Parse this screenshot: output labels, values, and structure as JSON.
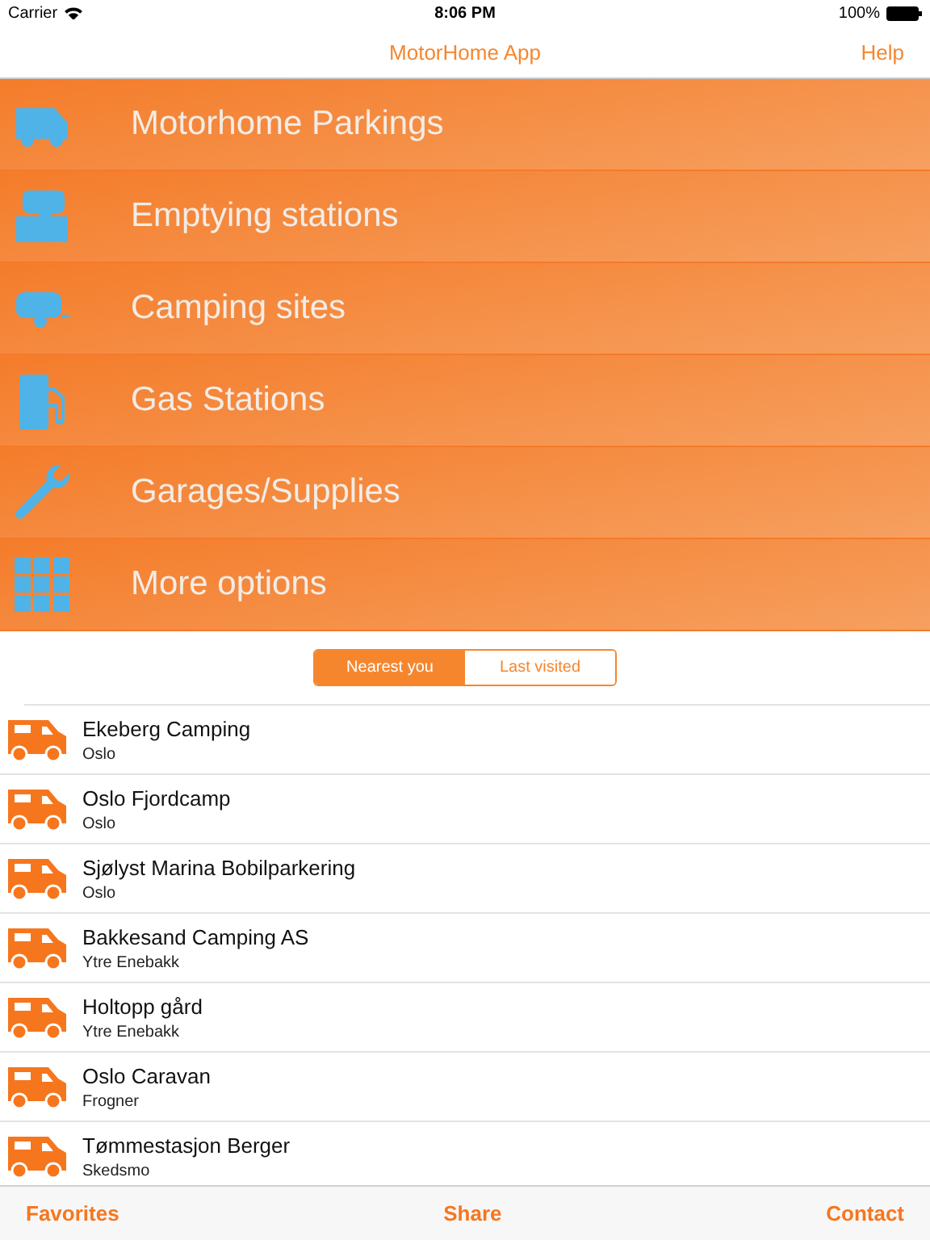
{
  "status_bar": {
    "carrier": "Carrier",
    "time": "8:06 PM",
    "battery": "100%"
  },
  "nav": {
    "title": "MotorHome App",
    "right": "Help"
  },
  "menu": [
    {
      "kind": "motorhome",
      "label": "Motorhome Parkings"
    },
    {
      "kind": "emptying",
      "label": "Emptying stations"
    },
    {
      "kind": "caravan",
      "label": "Camping sites"
    },
    {
      "kind": "fuel",
      "label": "Gas Stations"
    },
    {
      "kind": "wrench",
      "label": "Garages/Supplies"
    },
    {
      "kind": "grid",
      "label": "More options"
    }
  ],
  "segments": [
    {
      "label": "Nearest you",
      "selected": true
    },
    {
      "label": "Last visited",
      "selected": false
    }
  ],
  "places": [
    {
      "name": "Ekeberg Camping",
      "location": "Oslo"
    },
    {
      "name": "Oslo Fjordcamp",
      "location": "Oslo"
    },
    {
      "name": "Sjølyst Marina Bobilparkering",
      "location": "Oslo"
    },
    {
      "name": "Bakkesand Camping AS",
      "location": "Ytre Enebakk"
    },
    {
      "name": "Holtopp gård",
      "location": "Ytre Enebakk"
    },
    {
      "name": "Oslo Caravan",
      "location": "Frogner"
    },
    {
      "name": "Tømmestasjon Berger",
      "location": "Skedsmo"
    }
  ],
  "toolbar": [
    "Favorites",
    "Share",
    "Contact"
  ]
}
